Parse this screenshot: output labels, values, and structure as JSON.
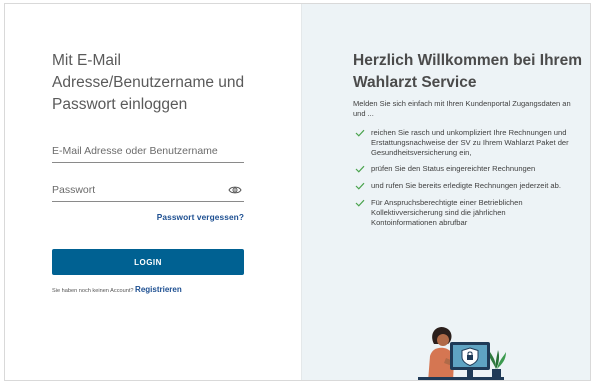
{
  "login": {
    "title": "Mit E-Mail Adresse/Benutzername und Passwort einloggen",
    "email_placeholder": "E-Mail Adresse oder Benutzername",
    "password_placeholder": "Passwort",
    "forgot_password": "Passwort vergessen?",
    "login_button": "LOGIN",
    "no_account_text": "Sie haben noch keinen Account?",
    "register_link": "Registrieren"
  },
  "welcome": {
    "title": "Herzlich Willkommen bei Ihrem Wahlarzt Service",
    "intro": "Melden Sie sich einfach mit Ihren Kundenportal Zugangsdaten an und ...",
    "benefits": [
      "reichen Sie rasch und unkompliziert Ihre Rechnungen und Erstattungsnachweise der SV zu Ihrem Wahlarzt Paket der Gesundheitsversicherung ein,",
      "prüfen Sie den Status eingereichter Rechnungen",
      "und rufen Sie bereits erledigte Rechnungen jederzeit ab.",
      "Für Anspruchsberechtigte einer Betrieblichen Kollektivversicherung sind die jährlichen Kontoinformationen abrufbar"
    ]
  },
  "colors": {
    "primary_button": "#006192",
    "link": "#1d4f91",
    "check": "#4aa34d",
    "right_panel_bg": "#edf3f6"
  },
  "icons": {
    "password_toggle": "eye-icon",
    "benefit_bullet": "check-icon",
    "illustration": "person-with-monitor-shield-illustration"
  }
}
